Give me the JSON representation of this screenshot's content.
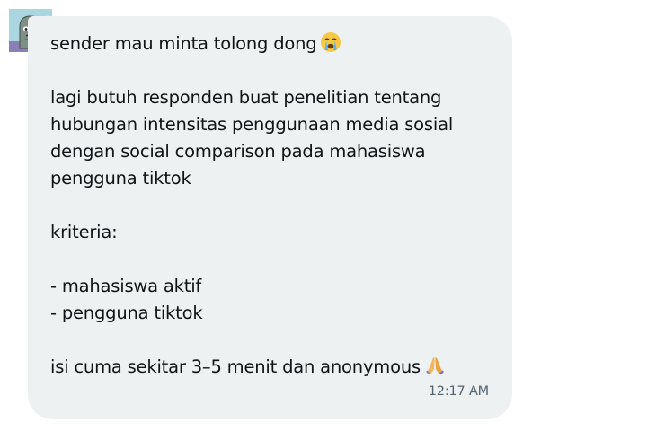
{
  "message": {
    "lines": [
      "sender mau minta tolong dong",
      "",
      "lagi butuh responden buat penelitian tentang",
      "hubungan intensitas penggunaan media sosial",
      "dengan social comparison pada mahasiswa",
      "pengguna tiktok",
      "",
      "kriteria:",
      "",
      "- mahasiswa aktif",
      "- pengguna tiktok",
      "",
      "isi cuma sekitar 3–5 menit dan anonymous"
    ],
    "emoji_first": "crying-face-icon",
    "emoji_last": "folded-hands-icon",
    "timestamp": "12:17 AM"
  },
  "colors": {
    "bubble_bg": "#eef1f2",
    "text": "#101418",
    "timestamp": "#536471",
    "avatar_bg": "#a9d6df"
  }
}
